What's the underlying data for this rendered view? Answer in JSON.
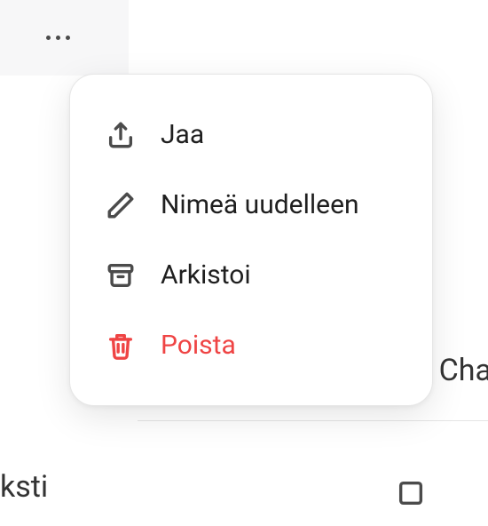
{
  "menu": {
    "items": [
      {
        "label": "Jaa",
        "icon": "share-icon",
        "destructive": false
      },
      {
        "label": "Nimeä uudelleen",
        "icon": "pencil-icon",
        "destructive": false
      },
      {
        "label": "Arkistoi",
        "icon": "archive-icon",
        "destructive": false
      },
      {
        "label": "Poista",
        "icon": "trash-icon",
        "destructive": true
      }
    ]
  },
  "background": {
    "text_right_fragment": "Cha",
    "text_left_fragment": "ksti"
  },
  "colors": {
    "destructive": "#ef4444",
    "icon_default": "#4b4b4b",
    "text_default": "#1f1f1f"
  }
}
